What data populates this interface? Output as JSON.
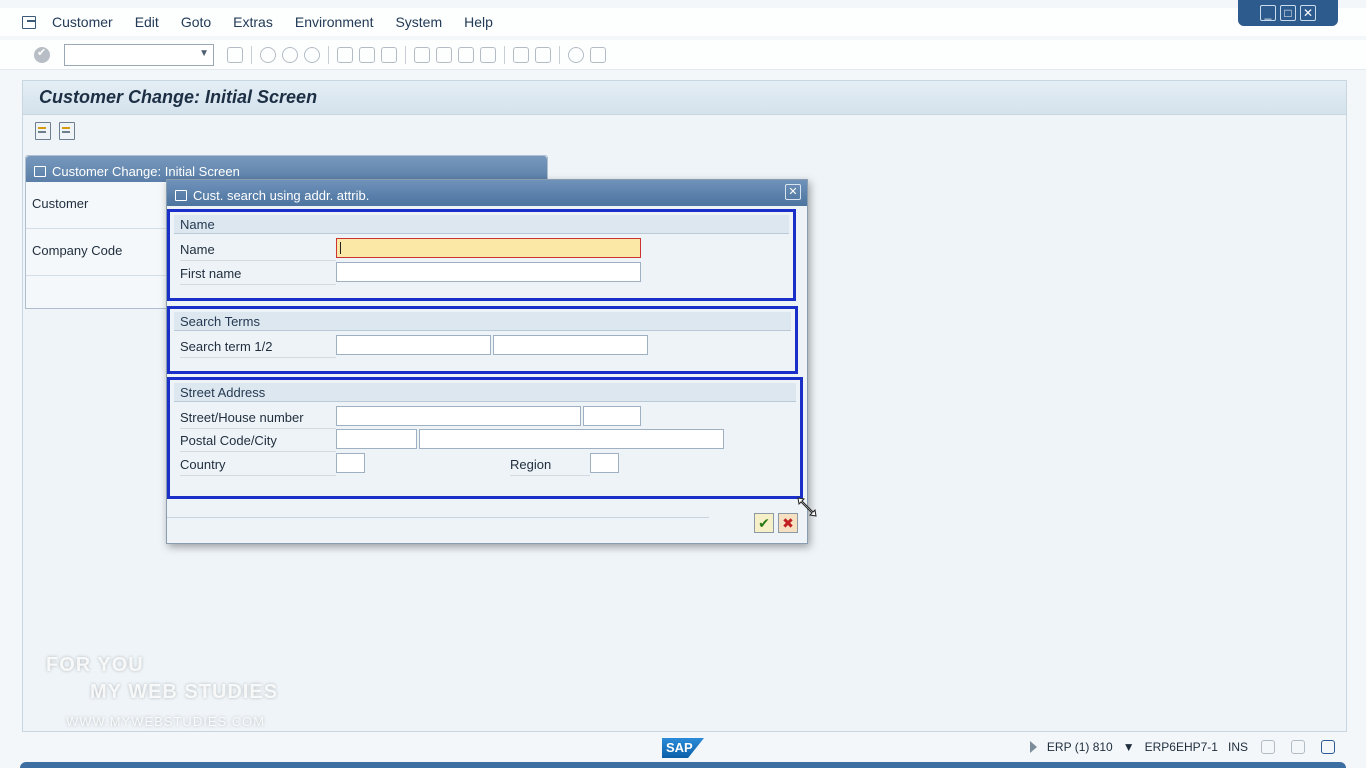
{
  "menu": [
    "Customer",
    "Edit",
    "Goto",
    "Extras",
    "Environment",
    "System",
    "Help"
  ],
  "window_controls": [
    "_",
    "□",
    "✕"
  ],
  "screen_title": "Customer Change: Initial Screen",
  "background_panel": {
    "title": "Customer Change: Initial Screen",
    "fields": [
      "Customer",
      "Company Code"
    ]
  },
  "dialog": {
    "title": "Cust. search using addr. attrib.",
    "close": "✕",
    "groups": {
      "name": {
        "title": "Name",
        "fields": {
          "name": "Name",
          "first_name": "First name"
        }
      },
      "search_terms": {
        "title": "Search Terms",
        "fields": {
          "search_term": "Search term 1/2"
        }
      },
      "street_address": {
        "title": "Street Address",
        "fields": {
          "street": "Street/House number",
          "postal": "Postal Code/City",
          "country": "Country",
          "region": "Region"
        }
      }
    },
    "ok_symbol": "✔",
    "cancel_symbol": "✖"
  },
  "watermark": {
    "line1": "FOR YOU",
    "line2": "MY WEB STUDIES",
    "line3": "WWW.MYWEBSTUDIES.COM"
  },
  "status": {
    "logo": "SAP",
    "system": "ERP (1) 810",
    "server": "ERP6EHP7-1",
    "mode": "INS"
  }
}
